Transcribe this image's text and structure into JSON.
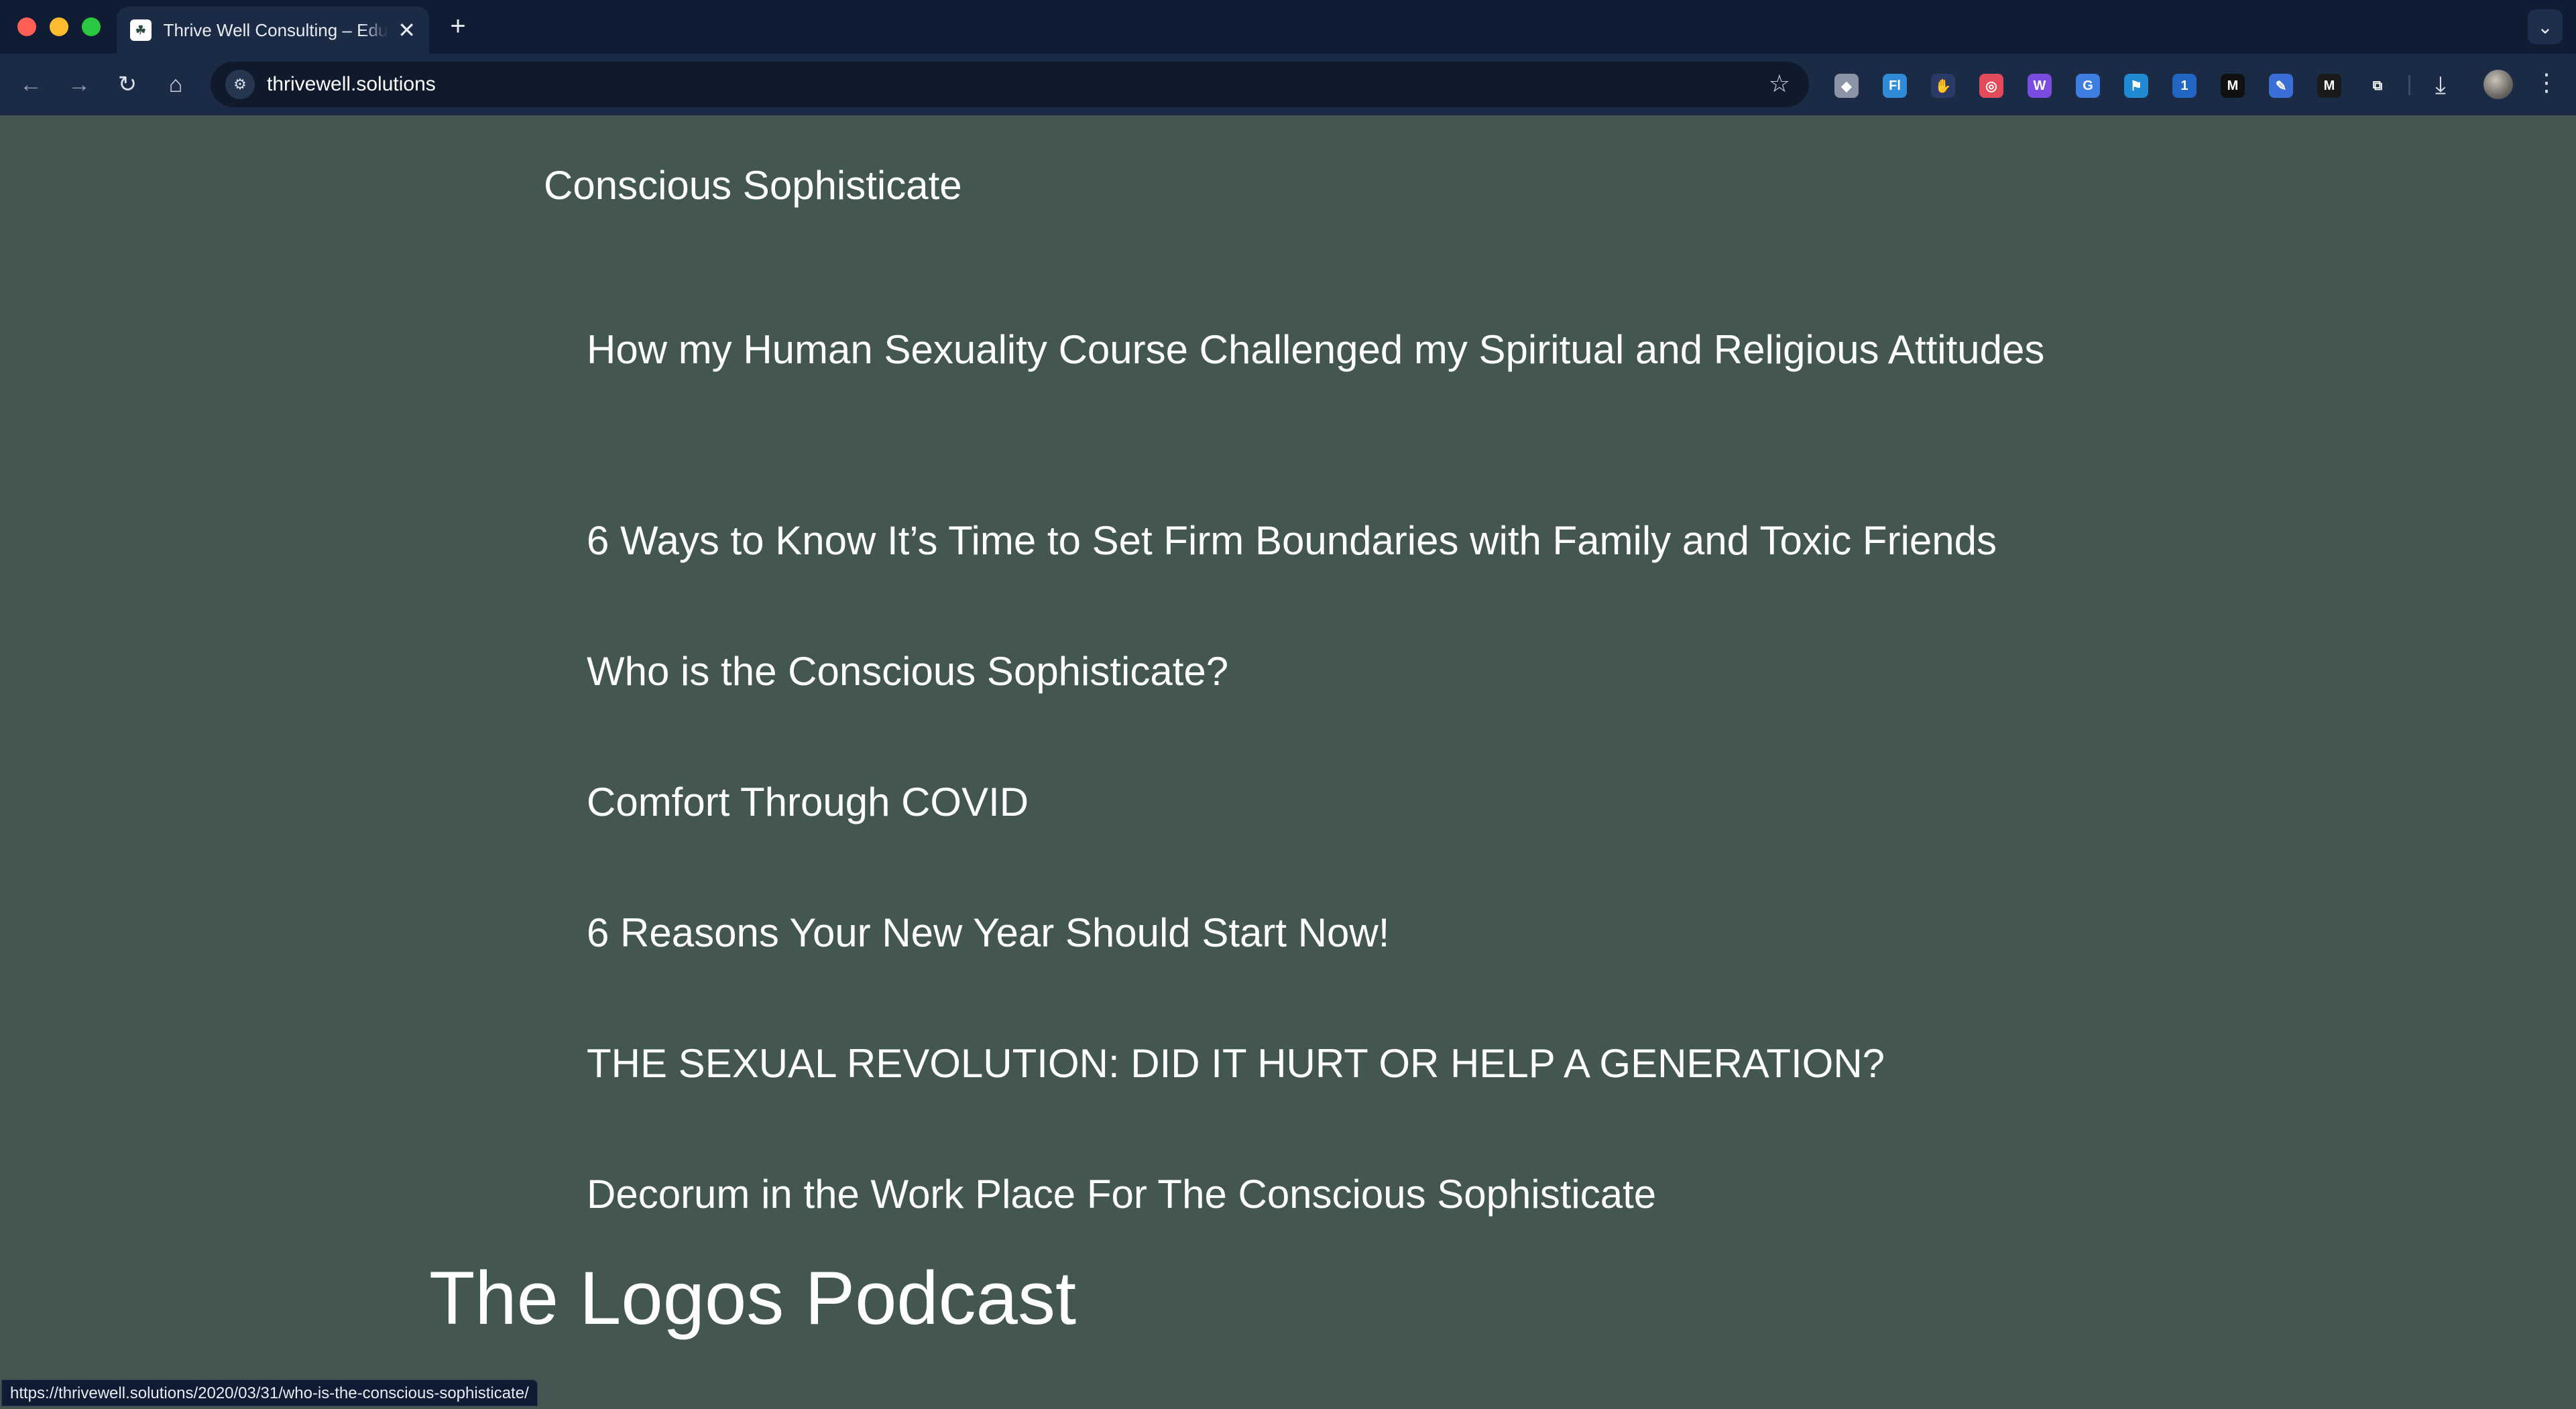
{
  "browser": {
    "tab": {
      "title": "Thrive Well Consulting – Educ",
      "close_glyph": "✕"
    },
    "new_tab_glyph": "+",
    "tab_search_glyph": "⌄",
    "address_bar": {
      "url": "thrivewell.solutions"
    },
    "icons": {
      "back": "←",
      "forward": "→",
      "reload": "↻",
      "home": "⌂",
      "site_info": "⚙",
      "bookmark": "☆",
      "download": "⤓",
      "menu": "⋮"
    },
    "extensions": [
      {
        "name": "shield-extension-icon",
        "glyph": "◆",
        "color": "#8a94a6"
      },
      {
        "name": "fl-extension-icon",
        "glyph": "Fl",
        "color": "#2f8bd8"
      },
      {
        "name": "hand-extension-icon",
        "glyph": "✋",
        "color": "#2a3a66"
      },
      {
        "name": "chrome-color-extension-icon",
        "glyph": "◎",
        "color": "#e34b5b"
      },
      {
        "name": "w-extension-icon",
        "glyph": "W",
        "color": "#7b4ce0"
      },
      {
        "name": "translate-extension-icon",
        "glyph": "G",
        "color": "#3d7ee0"
      },
      {
        "name": "flag-extension-icon",
        "glyph": "⚑",
        "color": "#1f8ad1"
      },
      {
        "name": "onepassword-extension-icon",
        "glyph": "1",
        "color": "#2367c4"
      },
      {
        "name": "m-black-extension-icon",
        "glyph": "M",
        "color": "#111111"
      },
      {
        "name": "blue-doc-extension-icon",
        "glyph": "✎",
        "color": "#3a6fd8"
      },
      {
        "name": "medium-extension-icon",
        "glyph": "M",
        "color": "#1a1a1a"
      },
      {
        "name": "puzzle-extension-icon",
        "glyph": "⧉",
        "color": "#1b2a45"
      }
    ],
    "status_url": "https://thrivewell.solutions/2020/03/31/who-is-the-conscious-sophisticate/"
  },
  "page": {
    "section_heading": "Conscious Sophisticate",
    "posts": [
      {
        "title": "How my Human Sexuality Course Challenged my Spiritual and Religious Attitudes"
      },
      {
        "title": "6 Ways to Know It’s Time to Set Firm Boundaries with Family and Toxic Friends"
      },
      {
        "title": "Who is the Conscious Sophisticate?"
      },
      {
        "title": "Comfort Through COVID"
      },
      {
        "title": "6 Reasons Your New Year Should Start Now!"
      },
      {
        "title": "THE SEXUAL REVOLUTION: DID IT HURT OR HELP A GENERATION?"
      },
      {
        "title": "Decorum in the Work Place For The Conscious Sophisticate"
      }
    ],
    "podcast_heading": "The Logos Podcast"
  },
  "colors": {
    "page_background": "#44574f",
    "browser_frame": "#0f1c33",
    "toolbar": "#1b2a45",
    "text": "#ffffff"
  }
}
